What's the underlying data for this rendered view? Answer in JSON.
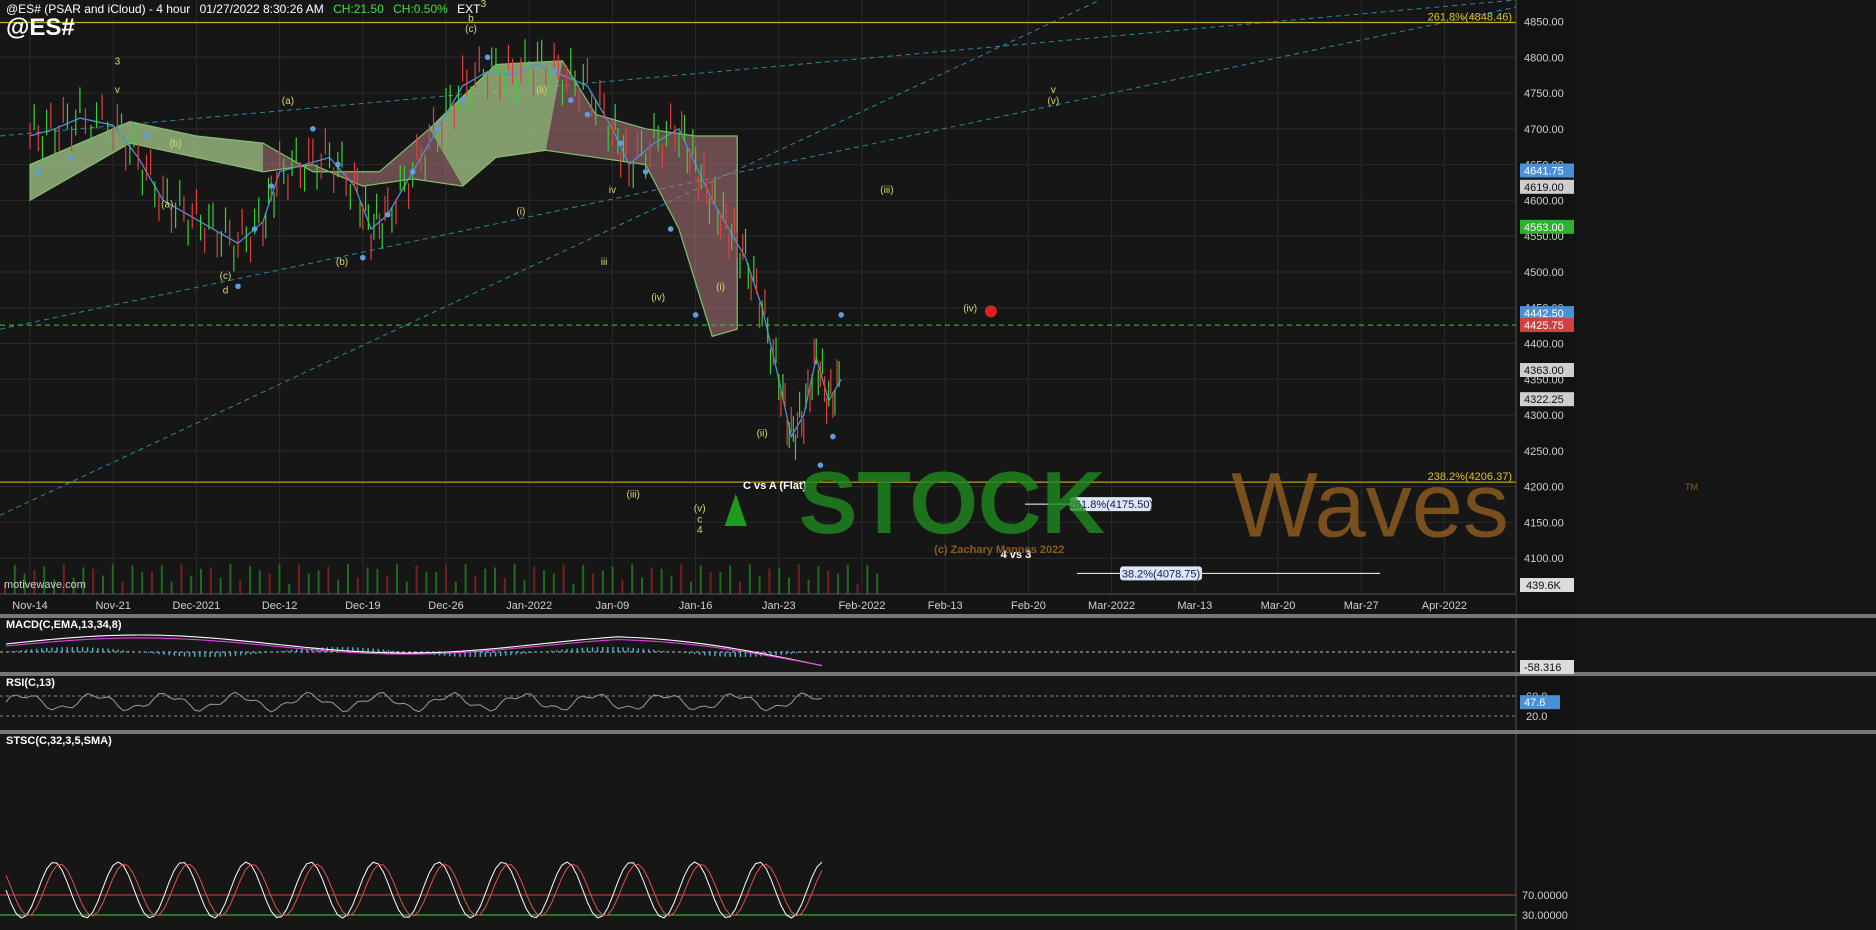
{
  "header": {
    "title": "@ES# (PSAR and iCloud) - 4 hour",
    "datetime": "01/27/2022 8:30:26 AM",
    "change": "CH:21.50",
    "change_pct": "CH:0.50%",
    "session": "EXT",
    "ticker": "@ES#",
    "source": "motivewave.com"
  },
  "colors": {
    "background": "#161616",
    "grid": "#2a2a2a",
    "price_line": "#4a90d9",
    "psar": "#5aa0e0",
    "cloud_bull": "#8fbf7a",
    "cloud_bear": "#b07a80",
    "fib_line": "#e0c020",
    "green_dash": "#2fd02f",
    "watermark_green": "#1f8a1f",
    "watermark_brown": "#8b5a1e"
  },
  "chart_data": [
    {
      "type": "line",
      "name_label": "Price",
      "x_categories": [
        "Nov-14",
        "Nov-21",
        "Dec-2021",
        "Dec-12",
        "Dec-19",
        "Dec-26",
        "Jan-2022",
        "Jan-09",
        "Jan-16",
        "Jan-23",
        "Feb-2022",
        "Feb-13",
        "Feb-20",
        "Mar-2022",
        "Mar-13",
        "Mar-20",
        "Mar-27",
        "Apr-2022"
      ],
      "ylim": [
        4050,
        4880
      ],
      "y_ticks": [
        4100,
        4150,
        4200,
        4250,
        4300,
        4350,
        4400,
        4450,
        4500,
        4550,
        4600,
        4650,
        4700,
        4750,
        4800,
        4850
      ],
      "series": [
        {
          "name": "close",
          "points": [
            [
              0,
              4690
            ],
            [
              0.3,
              4700
            ],
            [
              0.6,
              4715
            ],
            [
              1.0,
              4705
            ],
            [
              1.3,
              4660
            ],
            [
              1.6,
              4600
            ],
            [
              1.9,
              4580
            ],
            [
              2.2,
              4560
            ],
            [
              2.5,
              4540
            ],
            [
              2.8,
              4570
            ],
            [
              3.0,
              4640
            ],
            [
              3.3,
              4650
            ],
            [
              3.6,
              4660
            ],
            [
              3.9,
              4620
            ],
            [
              4.1,
              4560
            ],
            [
              4.3,
              4580
            ],
            [
              4.6,
              4640
            ],
            [
              4.9,
              4700
            ],
            [
              5.2,
              4760
            ],
            [
              5.5,
              4780
            ],
            [
              5.8,
              4775
            ],
            [
              6.1,
              4790
            ],
            [
              6.4,
              4775
            ],
            [
              6.7,
              4760
            ],
            [
              7.0,
              4700
            ],
            [
              7.2,
              4650
            ],
            [
              7.5,
              4680
            ],
            [
              7.8,
              4700
            ],
            [
              8.0,
              4650
            ],
            [
              8.2,
              4600
            ],
            [
              8.4,
              4560
            ],
            [
              8.6,
              4520
            ],
            [
              8.8,
              4450
            ],
            [
              9.0,
              4350
            ],
            [
              9.15,
              4270
            ],
            [
              9.3,
              4300
            ],
            [
              9.45,
              4380
            ],
            [
              9.6,
              4320
            ],
            [
              9.75,
              4350
            ]
          ]
        }
      ],
      "horizontal_levels": [
        {
          "value": 4848.46,
          "label": "261.8%(4848.46)",
          "style": "fib"
        },
        {
          "value": 4425.75,
          "label": "4425.75",
          "style": "green-dash"
        },
        {
          "value": 4206.37,
          "label": "238.2%(4206.37)",
          "style": "fib"
        }
      ],
      "projection_labels": [
        {
          "value": 4175.5,
          "label": "261.8%(4175.50)"
        },
        {
          "value": 4078.75,
          "label": "38.2%(4078.75)"
        }
      ],
      "price_tags": [
        {
          "value": 4641.75,
          "label": "4641.75",
          "color": "#4a90d9"
        },
        {
          "value": 4619.0,
          "label": "4619.00",
          "color": "#cfcfcf"
        },
        {
          "value": 4563.0,
          "label": "4563.00",
          "color": "#2fb02f"
        },
        {
          "value": 4442.5,
          "label": "4442.50",
          "color": "#4a90d9"
        },
        {
          "value": 4425.75,
          "label": "4425.75",
          "color": "#d04040"
        },
        {
          "value": 4363.0,
          "label": "4363.00",
          "color": "#cfcfcf"
        },
        {
          "value": 4322.25,
          "label": "4322.25",
          "color": "#cfcfcf"
        }
      ],
      "volume_label": "439.6K",
      "wave_labels": [
        {
          "text": "3",
          "x": 1.05,
          "y": 4790
        },
        {
          "text": "v",
          "x": 1.05,
          "y": 4750
        },
        {
          "text": "(a)",
          "x": 1.65,
          "y": 4590
        },
        {
          "text": "(b)",
          "x": 1.75,
          "y": 4675
        },
        {
          "text": "(c)",
          "x": 2.35,
          "y": 4490
        },
        {
          "text": "d",
          "x": 2.35,
          "y": 4470
        },
        {
          "text": "(a)",
          "x": 3.1,
          "y": 4735
        },
        {
          "text": "(b)",
          "x": 3.75,
          "y": 4510
        },
        {
          "text": "b",
          "x": 5.3,
          "y": 4850
        },
        {
          "text": "(c)",
          "x": 5.3,
          "y": 4835
        },
        {
          "text": "3",
          "x": 5.45,
          "y": 4870
        },
        {
          "text": "(ii)",
          "x": 6.15,
          "y": 4750
        },
        {
          "text": "(i)",
          "x": 5.9,
          "y": 4580
        },
        {
          "text": "iv",
          "x": 7.0,
          "y": 4610
        },
        {
          "text": "iii",
          "x": 6.9,
          "y": 4510
        },
        {
          "text": "(iv)",
          "x": 7.55,
          "y": 4460
        },
        {
          "text": "(iii)",
          "x": 7.25,
          "y": 4185
        },
        {
          "text": "(v)",
          "x": 8.05,
          "y": 4165
        },
        {
          "text": "c",
          "x": 8.05,
          "y": 4150
        },
        {
          "text": "4",
          "x": 8.05,
          "y": 4135
        },
        {
          "text": "(i)",
          "x": 8.3,
          "y": 4475
        },
        {
          "text": "(ii)",
          "x": 8.8,
          "y": 4270
        },
        {
          "text": "(iii)",
          "x": 10.3,
          "y": 4610
        },
        {
          "text": "(iv)",
          "x": 11.3,
          "y": 4445
        },
        {
          "text": "v",
          "x": 12.3,
          "y": 4750
        },
        {
          "text": "(v)",
          "x": 12.3,
          "y": 4735
        }
      ],
      "annotations": [
        {
          "text": "C vs A (Flat)",
          "x": 8.95,
          "y": 4197
        },
        {
          "text": "4 vs 3",
          "x": 11.85,
          "y": 4100
        },
        {
          "text": "(c) Zachary Mannes 2022",
          "x": 11.65,
          "y": 4107
        }
      ]
    },
    {
      "type": "line",
      "title": "MACD(C,EMA,13,34,8)",
      "value_label": "-58.316"
    },
    {
      "type": "line",
      "title": "RSI(C,13)",
      "y_ticks": [
        20.0,
        60.0
      ],
      "value_label": "47.6"
    },
    {
      "type": "line",
      "title": "STSC(C,32,3,5,SMA)",
      "y_ticks": [
        30.0,
        70.0
      ],
      "tick_labels": [
        "30.00000",
        "70.00000"
      ]
    }
  ],
  "watermark": {
    "left": "STOCK",
    "right": "Waves",
    "tm": "TM"
  }
}
